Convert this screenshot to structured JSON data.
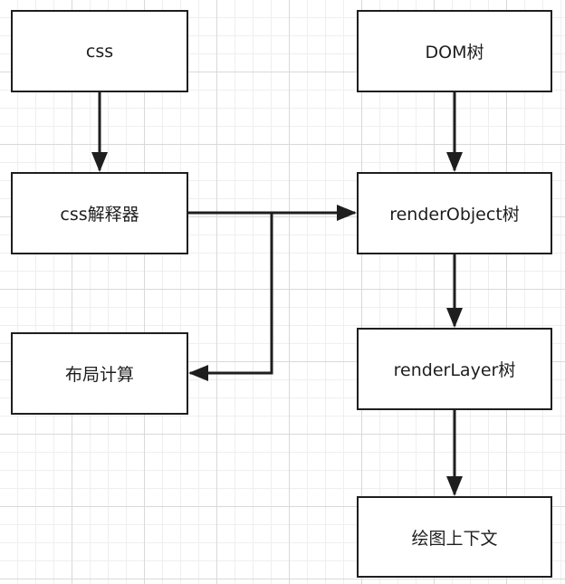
{
  "diagram": {
    "nodes": [
      {
        "id": "css",
        "label": "css"
      },
      {
        "id": "css-parser",
        "label": "css解释器"
      },
      {
        "id": "layout",
        "label": "布局计算"
      },
      {
        "id": "dom",
        "label": "DOM树"
      },
      {
        "id": "render-object",
        "label": "renderObject树"
      },
      {
        "id": "render-layer",
        "label": "renderLayer树"
      },
      {
        "id": "drawing-context",
        "label": "绘图上下文"
      }
    ],
    "edges": [
      {
        "from": "css",
        "to": "css-parser"
      },
      {
        "from": "dom",
        "to": "render-object"
      },
      {
        "from": "css-parser",
        "to": "render-object"
      },
      {
        "from": "css-parser",
        "to": "layout"
      },
      {
        "from": "render-object",
        "to": "render-layer"
      },
      {
        "from": "render-layer",
        "to": "drawing-context"
      }
    ],
    "colors": {
      "stroke": "#1e1e1e",
      "node_fill": "#ffffff",
      "grid_major": "#d9d9d9",
      "grid_minor": "#efefef"
    }
  }
}
